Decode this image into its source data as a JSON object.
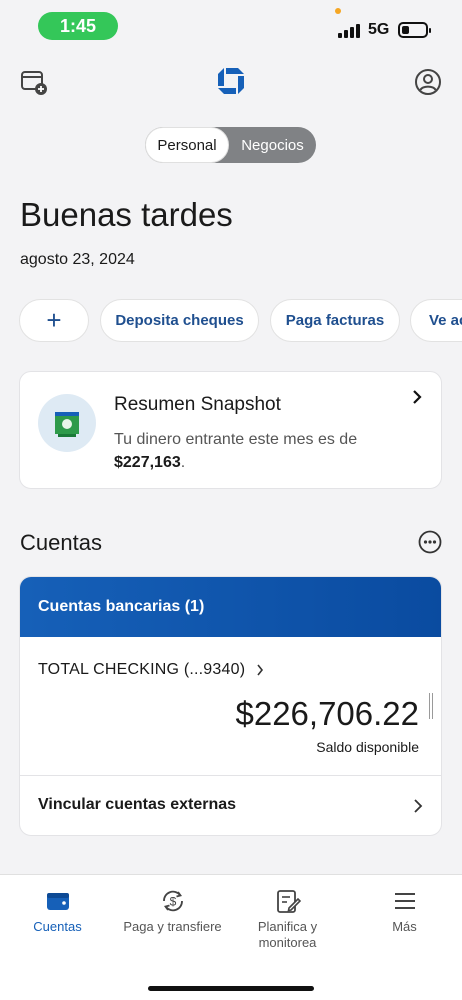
{
  "status_bar": {
    "time": "1:45",
    "network": "5G"
  },
  "segment": {
    "active": "Personal",
    "inactive": "Negocios"
  },
  "greeting": "Buenas tardes",
  "date": "agosto 23, 2024",
  "quick_actions": {
    "add_label": "+",
    "items": [
      "Deposita cheques",
      "Paga facturas",
      "Ve ac"
    ]
  },
  "snapshot": {
    "title": "Resumen Snapshot",
    "text_prefix": "Tu dinero entrante este mes es de ",
    "amount": "$227,163",
    "text_suffix": "."
  },
  "accounts": {
    "section_title": "Cuentas",
    "group_title": "Cuentas bancarias (1)",
    "account_name": "TOTAL CHECKING (...9340)",
    "balance": "$226,706.22",
    "balance_label": "Saldo disponible",
    "link_external": "Vincular cuentas externas"
  },
  "bottom_nav": [
    {
      "label": "Cuentas",
      "icon": "wallet-icon",
      "active": true
    },
    {
      "label": "Paga y transfiere",
      "icon": "dollar-cycle-icon",
      "active": false
    },
    {
      "label": "Planifica y monitorea",
      "icon": "planner-icon",
      "active": false
    },
    {
      "label": "Más",
      "icon": "menu-icon",
      "active": false
    }
  ],
  "colors": {
    "brand_blue": "#1660b8",
    "status_green": "#34c759",
    "segment_gray": "#808285"
  }
}
